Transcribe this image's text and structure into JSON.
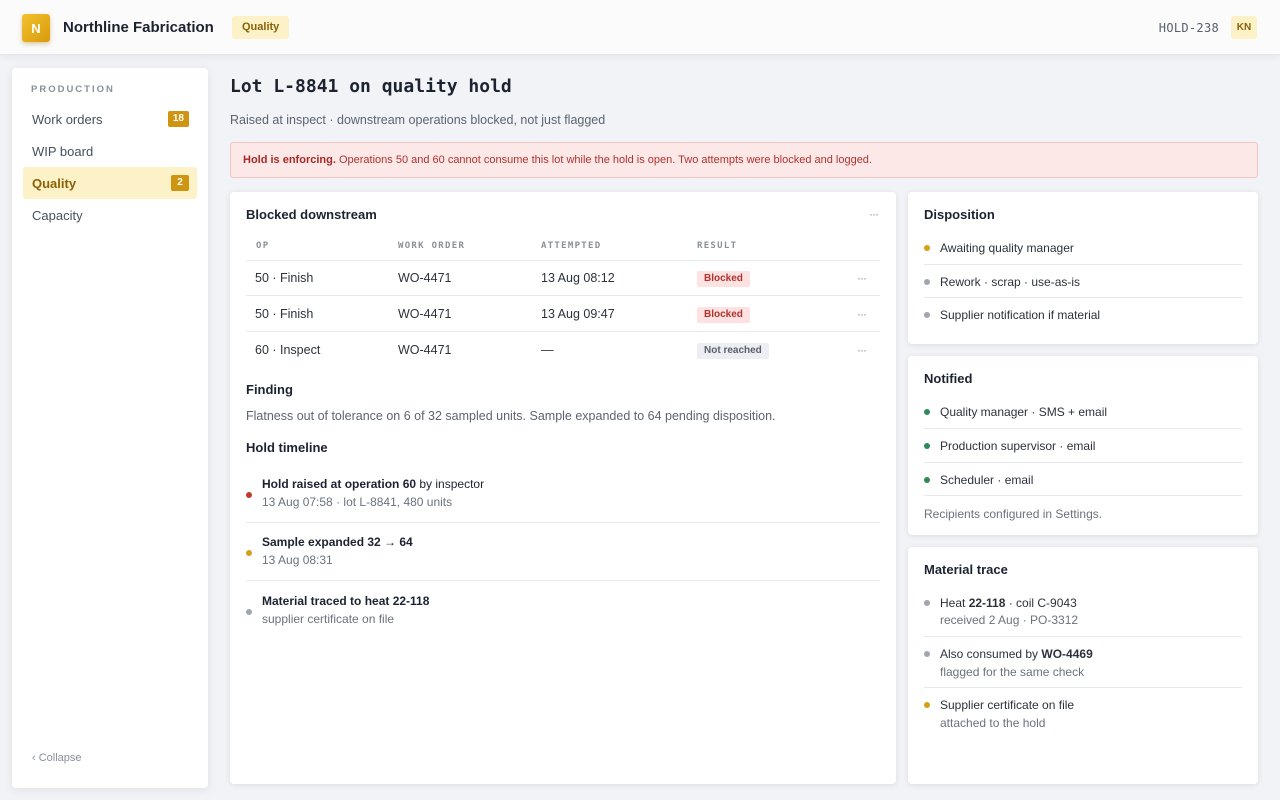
{
  "app": {
    "logo_letter": "N",
    "name": "Northline Fabrication",
    "module": "Quality",
    "hold_id": "HOLD-238",
    "user_initials": "KN"
  },
  "sidebar": {
    "section": "PRODUCTION",
    "items": [
      {
        "label": "Work orders",
        "count": "18"
      },
      {
        "label": "WIP board"
      },
      {
        "label": "Quality",
        "count": "2",
        "active": true
      },
      {
        "label": "Capacity"
      }
    ],
    "collapse": "‹ Collapse"
  },
  "page": {
    "title": "Lot L-8841 on quality hold",
    "subtitle": "Raised at inspect · downstream operations blocked, not just flagged",
    "alert_strong": "Hold is enforcing.",
    "alert_text": " Operations 50 and 60 cannot consume this lot while the hold is open. Two attempts were blocked and logged."
  },
  "blocked": {
    "title": "Blocked downstream",
    "columns": [
      "OP",
      "WORK ORDER",
      "ATTEMPTED",
      "RESULT"
    ],
    "rows": [
      {
        "op": "50 · Finish",
        "wo": "WO-4471",
        "attempted": "13 Aug 08:12",
        "result": "Blocked"
      },
      {
        "op": "50 · Finish",
        "wo": "WO-4471",
        "attempted": "13 Aug 09:47",
        "result": "Blocked"
      },
      {
        "op": "60 · Inspect",
        "wo": "WO-4471",
        "attempted": "—",
        "result": "Not reached"
      }
    ],
    "more_glyph": "···"
  },
  "finding": {
    "title": "Finding",
    "text": "Flatness out of tolerance on 6 of 32 sampled units. Sample expanded to 64 pending disposition."
  },
  "timeline": {
    "title": "Hold timeline",
    "items": [
      {
        "main_bold": "Hold raised at operation 60",
        "main_rest": " by inspector",
        "sub": "13 Aug 07:58 · lot L-8841, 480 units",
        "color": "#c0392b"
      },
      {
        "main_bold": "Sample expanded 32 → 64",
        "main_rest": "",
        "sub": "13 Aug 08:31",
        "color": "#d4a017"
      },
      {
        "main_bold": "Material traced to heat 22-118",
        "main_rest": "",
        "sub": "supplier certificate on file",
        "color": "#a0a6b0"
      }
    ]
  },
  "disposition": {
    "title": "Disposition",
    "items": [
      {
        "text": "Awaiting quality manager",
        "color": "#d4a017"
      },
      {
        "text": "Rework · scrap · use-as-is",
        "color": "#a0a6b0"
      },
      {
        "text": "Supplier notification if material",
        "color": "#a0a6b0"
      }
    ]
  },
  "notified": {
    "title": "Notified",
    "items": [
      {
        "text": "Quality manager · SMS + email",
        "color": "#2e8b57"
      },
      {
        "text": "Production supervisor · email",
        "color": "#2e8b57"
      },
      {
        "text": "Scheduler · email",
        "color": "#2e8b57"
      }
    ],
    "note": "Recipients configured in Settings."
  },
  "trace": {
    "title": "Material trace",
    "items": [
      {
        "pre": "Heat ",
        "bold": "22-118",
        "post": " · coil C-9043",
        "sub": "received 2 Aug · PO-3312",
        "color": "#a0a6b0"
      },
      {
        "pre": "Also consumed by ",
        "bold": "WO-4469",
        "post": "",
        "sub": "flagged for the same check",
        "color": "#a0a6b0"
      },
      {
        "pre": "Supplier certificate on file",
        "bold": "",
        "post": "",
        "sub": "attached to the hold",
        "color": "#d4a017"
      }
    ]
  },
  "colors": {
    "accent": "#cf9410",
    "danger": "#b0322e",
    "ok": "#2e8b57"
  }
}
